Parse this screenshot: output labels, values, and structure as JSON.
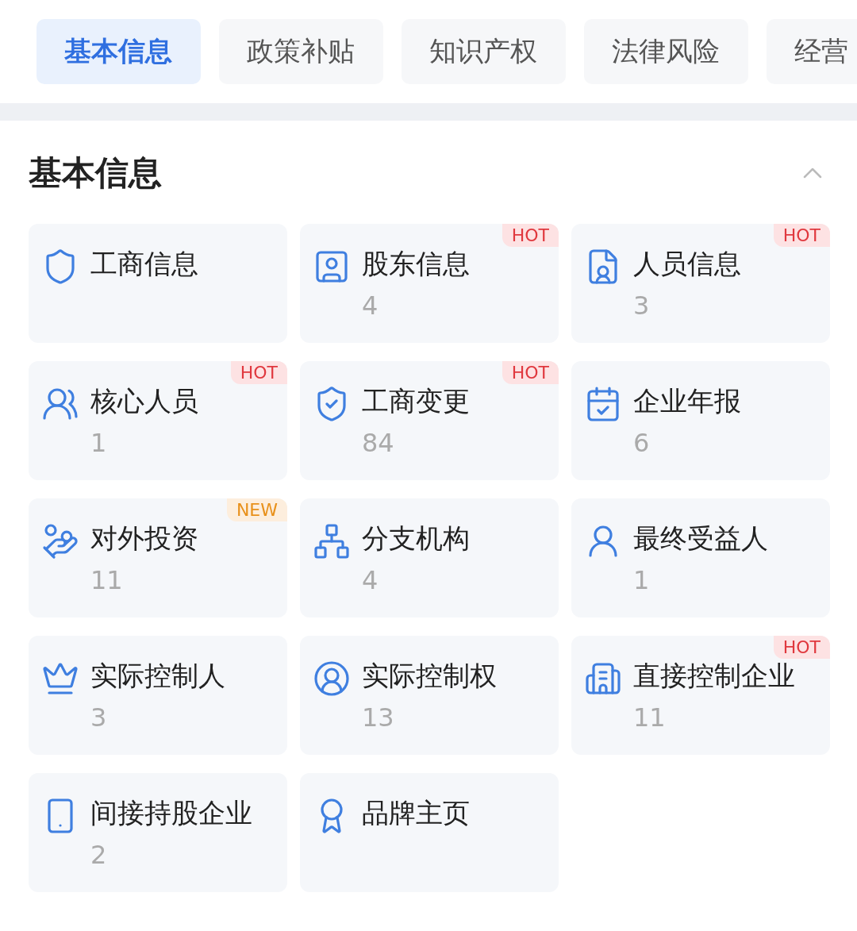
{
  "tabs": [
    {
      "label": "基本信息",
      "selected": true
    },
    {
      "label": "政策补贴",
      "selected": false
    },
    {
      "label": "知识产权",
      "selected": false
    },
    {
      "label": "法律风险",
      "selected": false
    },
    {
      "label": "经营",
      "selected": false
    }
  ],
  "section": {
    "title": "基本信息",
    "expanded": true
  },
  "cards": [
    {
      "title": "工商信息"
    },
    {
      "title": "股东信息",
      "count": "4",
      "badge": {
        "kind": "hot",
        "text": "HOT"
      }
    },
    {
      "title": "人员信息",
      "count": "3",
      "badge": {
        "kind": "hot",
        "text": "HOT"
      }
    },
    {
      "title": "核心人员",
      "count": "1",
      "badge": {
        "kind": "hot",
        "text": "HOT"
      }
    },
    {
      "title": "工商变更",
      "count": "84",
      "badge": {
        "kind": "hot",
        "text": "HOT"
      }
    },
    {
      "title": "企业年报",
      "count": "6"
    },
    {
      "title": "对外投资",
      "count": "11",
      "badge": {
        "kind": "new",
        "text": "NEW"
      }
    },
    {
      "title": "分支机构",
      "count": "4"
    },
    {
      "title": "最终受益人",
      "count": "1"
    },
    {
      "title": "实际控制人",
      "count": "3"
    },
    {
      "title": "实际控制权",
      "count": "13"
    },
    {
      "title": "直接控制企业",
      "count": "11",
      "badge": {
        "kind": "hot",
        "text": "HOT"
      }
    },
    {
      "title": "间接持股企业",
      "count": "2"
    },
    {
      "title": "品牌主页"
    }
  ]
}
